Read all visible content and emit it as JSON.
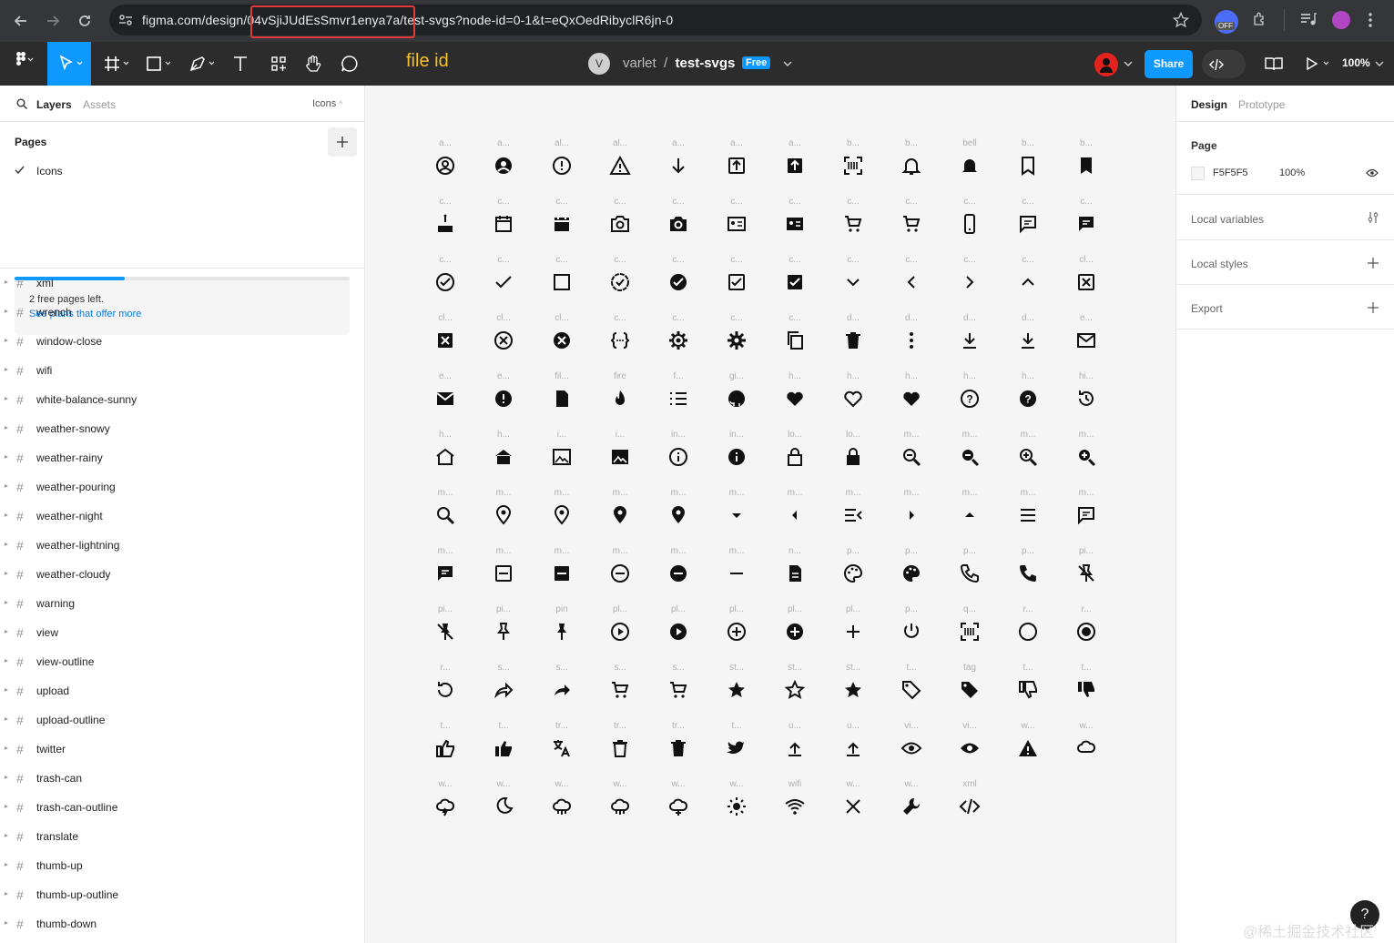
{
  "browser": {
    "url_prefix": "figma.com/design/",
    "url_file_id": "04vSjiJUdEsSmvr1enya7a",
    "url_suffix": "/test-svgs?node-id=0-1&t=eQxOedRibyclR6jn-0",
    "ext_badge": "OFF"
  },
  "toolbar": {
    "annotation": "file id",
    "team": "varlet",
    "team_initial": "V",
    "file_name": "test-svgs",
    "plan_badge": "Free",
    "share_label": "Share",
    "zoom": "100%"
  },
  "left_panel": {
    "tab_layers": "Layers",
    "tab_assets": "Assets",
    "page_dropdown": "Icons",
    "pages_title": "Pages",
    "current_page": "Icons",
    "pages_left": "2 free pages left.",
    "plans_link": "See plans that offer more",
    "pages_used_fraction": 0.33,
    "layers": [
      "xml",
      "wrench",
      "window-close",
      "wifi",
      "white-balance-sunny",
      "weather-snowy",
      "weather-rainy",
      "weather-pouring",
      "weather-night",
      "weather-lightning",
      "weather-cloudy",
      "warning",
      "view",
      "view-outline",
      "upload",
      "upload-outline",
      "twitter",
      "trash-can",
      "trash-can-outline",
      "translate",
      "thumb-up",
      "thumb-up-outline",
      "thumb-down"
    ]
  },
  "canvas": {
    "rows": [
      [
        {
          "label": "a...",
          "icon": "account-circle-outline-icon"
        },
        {
          "label": "a...",
          "icon": "account-circle-icon"
        },
        {
          "label": "al...",
          "icon": "alert-circle-outline-icon"
        },
        {
          "label": "al...",
          "icon": "alert-outline-icon"
        },
        {
          "label": "a...",
          "icon": "arrow-down-icon"
        },
        {
          "label": "a...",
          "icon": "arrow-up-box-outline-icon"
        },
        {
          "label": "a...",
          "icon": "arrow-up-box-icon"
        },
        {
          "label": "b...",
          "icon": "barcode-scan-icon"
        },
        {
          "label": "b...",
          "icon": "bell-outline-icon"
        },
        {
          "label": "bell",
          "icon": "bell-icon"
        },
        {
          "label": "b...",
          "icon": "bookmark-outline-icon"
        },
        {
          "label": "b...",
          "icon": "bookmark-icon"
        }
      ],
      [
        {
          "label": "c...",
          "icon": "cake-icon"
        },
        {
          "label": "c...",
          "icon": "calendar-outline-icon"
        },
        {
          "label": "c...",
          "icon": "calendar-icon"
        },
        {
          "label": "c...",
          "icon": "camera-outline-icon"
        },
        {
          "label": "c...",
          "icon": "camera-icon"
        },
        {
          "label": "c...",
          "icon": "card-account-outline-icon"
        },
        {
          "label": "c...",
          "icon": "card-account-icon"
        },
        {
          "label": "c...",
          "icon": "cart-outline-icon"
        },
        {
          "label": "c...",
          "icon": "cart-icon"
        },
        {
          "label": "c...",
          "icon": "cellphone-icon"
        },
        {
          "label": "c...",
          "icon": "chat-outline-icon"
        },
        {
          "label": "c...",
          "icon": "chat-icon"
        }
      ],
      [
        {
          "label": "c...",
          "icon": "check-circle-outline-icon"
        },
        {
          "label": "c...",
          "icon": "check-icon"
        },
        {
          "label": "c...",
          "icon": "checkbox-blank-outline-icon"
        },
        {
          "label": "c...",
          "icon": "check-decagram-outline-icon"
        },
        {
          "label": "c...",
          "icon": "check-circle-icon"
        },
        {
          "label": "c...",
          "icon": "checkbox-outline-icon"
        },
        {
          "label": "c...",
          "icon": "checkbox-marked-icon"
        },
        {
          "label": "c...",
          "icon": "chevron-down-icon"
        },
        {
          "label": "c...",
          "icon": "chevron-left-icon"
        },
        {
          "label": "c...",
          "icon": "chevron-right-icon"
        },
        {
          "label": "c...",
          "icon": "chevron-up-icon"
        },
        {
          "label": "cl...",
          "icon": "close-box-outline-icon"
        }
      ],
      [
        {
          "label": "cl...",
          "icon": "close-box-icon"
        },
        {
          "label": "cl...",
          "icon": "close-circle-outline-icon"
        },
        {
          "label": "cl...",
          "icon": "close-circle-icon"
        },
        {
          "label": "c...",
          "icon": "code-braces-icon"
        },
        {
          "label": "c...",
          "icon": "cog-outline-icon"
        },
        {
          "label": "c...",
          "icon": "cog-icon"
        },
        {
          "label": "c...",
          "icon": "content-copy-icon"
        },
        {
          "label": "d...",
          "icon": "delete-icon"
        },
        {
          "label": "d...",
          "icon": "dots-vertical-icon"
        },
        {
          "label": "d...",
          "icon": "download-outline-icon"
        },
        {
          "label": "d...",
          "icon": "download-icon"
        },
        {
          "label": "e...",
          "icon": "email-outline-icon"
        }
      ],
      [
        {
          "label": "e...",
          "icon": "email-icon"
        },
        {
          "label": "e...",
          "icon": "exclamation-circle-icon"
        },
        {
          "label": "fil...",
          "icon": "file-document-icon"
        },
        {
          "label": "fire",
          "icon": "fire-icon"
        },
        {
          "label": "f...",
          "icon": "format-list-icon"
        },
        {
          "label": "gi...",
          "icon": "github-icon"
        },
        {
          "label": "h...",
          "icon": "heart-half-icon"
        },
        {
          "label": "h...",
          "icon": "heart-outline-icon"
        },
        {
          "label": "h...",
          "icon": "heart-icon"
        },
        {
          "label": "h...",
          "icon": "help-circle-outline-icon"
        },
        {
          "label": "h...",
          "icon": "help-circle-icon"
        },
        {
          "label": "hi...",
          "icon": "history-icon"
        }
      ],
      [
        {
          "label": "h...",
          "icon": "home-outline-icon"
        },
        {
          "label": "h...",
          "icon": "home-icon"
        },
        {
          "label": "i...",
          "icon": "image-outline-icon"
        },
        {
          "label": "i...",
          "icon": "image-icon"
        },
        {
          "label": "in...",
          "icon": "information-outline-icon"
        },
        {
          "label": "in...",
          "icon": "information-icon"
        },
        {
          "label": "lo...",
          "icon": "lock-outline-icon"
        },
        {
          "label": "lo...",
          "icon": "lock-icon"
        },
        {
          "label": "m...",
          "icon": "magnify-minus-outline-icon"
        },
        {
          "label": "m...",
          "icon": "magnify-minus-icon"
        },
        {
          "label": "m...",
          "icon": "magnify-plus-outline-icon"
        },
        {
          "label": "m...",
          "icon": "magnify-plus-icon"
        }
      ],
      [
        {
          "label": "m...",
          "icon": "magnify-icon"
        },
        {
          "label": "m...",
          "icon": "map-marker-outline-icon"
        },
        {
          "label": "m...",
          "icon": "map-marker-radius-outline-icon"
        },
        {
          "label": "m...",
          "icon": "map-marker-radius-icon"
        },
        {
          "label": "m...",
          "icon": "map-marker-icon"
        },
        {
          "label": "m...",
          "icon": "menu-down-icon"
        },
        {
          "label": "m...",
          "icon": "menu-left-icon"
        },
        {
          "label": "m...",
          "icon": "menu-open-icon"
        },
        {
          "label": "m...",
          "icon": "menu-right-icon"
        },
        {
          "label": "m...",
          "icon": "menu-up-icon"
        },
        {
          "label": "m...",
          "icon": "menu-icon"
        },
        {
          "label": "m...",
          "icon": "message-text-outline-icon"
        }
      ],
      [
        {
          "label": "m...",
          "icon": "message-text-icon"
        },
        {
          "label": "m...",
          "icon": "minus-box-outline-icon"
        },
        {
          "label": "m...",
          "icon": "minus-box-icon"
        },
        {
          "label": "m...",
          "icon": "minus-circle-outline-icon"
        },
        {
          "label": "m...",
          "icon": "minus-circle-icon"
        },
        {
          "label": "m...",
          "icon": "minus-icon"
        },
        {
          "label": "n...",
          "icon": "notebook-icon"
        },
        {
          "label": "p...",
          "icon": "palette-outline-icon"
        },
        {
          "label": "p...",
          "icon": "palette-icon"
        },
        {
          "label": "p...",
          "icon": "phone-outline-icon"
        },
        {
          "label": "p...",
          "icon": "phone-icon"
        },
        {
          "label": "pi...",
          "icon": "pin-off-outline-icon"
        }
      ],
      [
        {
          "label": "pi...",
          "icon": "pin-off-icon"
        },
        {
          "label": "pi...",
          "icon": "pin-outline-icon"
        },
        {
          "label": "pin",
          "icon": "pin-icon"
        },
        {
          "label": "pl...",
          "icon": "play-circle-outline-icon"
        },
        {
          "label": "pl...",
          "icon": "play-circle-icon"
        },
        {
          "label": "pl...",
          "icon": "plus-circle-outline-icon"
        },
        {
          "label": "pl...",
          "icon": "plus-circle-icon"
        },
        {
          "label": "pl...",
          "icon": "plus-icon"
        },
        {
          "label": "p...",
          "icon": "power-icon"
        },
        {
          "label": "q...",
          "icon": "qrcode-scan-icon"
        },
        {
          "label": "r...",
          "icon": "radiobox-blank-icon"
        },
        {
          "label": "r...",
          "icon": "radiobox-marked-icon"
        }
      ],
      [
        {
          "label": "r...",
          "icon": "refresh-icon"
        },
        {
          "label": "s...",
          "icon": "share-outline-icon"
        },
        {
          "label": "s...",
          "icon": "share-icon"
        },
        {
          "label": "s...",
          "icon": "shopping-outline-icon"
        },
        {
          "label": "s...",
          "icon": "shopping-icon"
        },
        {
          "label": "st...",
          "icon": "star-half-icon"
        },
        {
          "label": "st...",
          "icon": "star-outline-icon"
        },
        {
          "label": "st...",
          "icon": "star-icon"
        },
        {
          "label": "t...",
          "icon": "tag-outline-icon"
        },
        {
          "label": "tag",
          "icon": "tag-icon"
        },
        {
          "label": "t...",
          "icon": "thumb-down-outline-icon"
        },
        {
          "label": "t...",
          "icon": "thumb-down-icon"
        }
      ],
      [
        {
          "label": "t...",
          "icon": "thumb-up-outline-icon"
        },
        {
          "label": "t...",
          "icon": "thumb-up-icon"
        },
        {
          "label": "tr...",
          "icon": "translate-icon"
        },
        {
          "label": "tr...",
          "icon": "trash-can-outline-icon"
        },
        {
          "label": "tr...",
          "icon": "trash-can-icon"
        },
        {
          "label": "t...",
          "icon": "twitter-icon"
        },
        {
          "label": "u...",
          "icon": "upload-outline-icon"
        },
        {
          "label": "u...",
          "icon": "upload-icon"
        },
        {
          "label": "vi...",
          "icon": "view-outline-icon"
        },
        {
          "label": "vi...",
          "icon": "view-icon"
        },
        {
          "label": "w...",
          "icon": "warning-icon"
        },
        {
          "label": "w...",
          "icon": "weather-cloudy-icon"
        }
      ],
      [
        {
          "label": "w...",
          "icon": "weather-lightning-icon"
        },
        {
          "label": "w...",
          "icon": "weather-night-icon"
        },
        {
          "label": "w...",
          "icon": "weather-pouring-icon"
        },
        {
          "label": "w...",
          "icon": "weather-rainy-icon"
        },
        {
          "label": "w...",
          "icon": "weather-snowy-icon"
        },
        {
          "label": "w...",
          "icon": "white-balance-sunny-icon"
        },
        {
          "label": "wifi",
          "icon": "wifi-icon"
        },
        {
          "label": "w...",
          "icon": "window-close-icon"
        },
        {
          "label": "w...",
          "icon": "wrench-icon"
        },
        {
          "label": "xml",
          "icon": "xml-icon"
        }
      ]
    ]
  },
  "right_panel": {
    "tab_design": "Design",
    "tab_prototype": "Prototype",
    "page_section": "Page",
    "page_color": "F5F5F5",
    "page_opacity": "100%",
    "local_variables": "Local variables",
    "local_styles": "Local styles",
    "export": "Export"
  },
  "watermark": "@稀土掘金技术社区",
  "help": "?",
  "colors": {
    "accent": "#0d99ff",
    "toolbar_bg": "#2c2c2c",
    "canvas_bg": "#f5f5f5",
    "highlight": "#e03a3a",
    "annotation": "#f6c02a"
  }
}
